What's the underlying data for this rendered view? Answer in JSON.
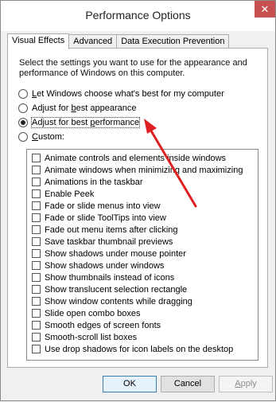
{
  "window": {
    "title": "Performance Options",
    "close_glyph": "✕"
  },
  "tabs": [
    {
      "label": "Visual Effects",
      "active": true
    },
    {
      "label": "Advanced",
      "active": false
    },
    {
      "label": "Data Execution Prevention",
      "active": false
    }
  ],
  "panel": {
    "description": "Select the settings you want to use for the appearance and performance of Windows on this computer.",
    "radios": [
      {
        "pre": "",
        "key": "L",
        "post": "et Windows choose what's best for my computer",
        "checked": false
      },
      {
        "pre": "Adjust for ",
        "key": "b",
        "post": "est appearance",
        "checked": false
      },
      {
        "pre": "Adjust for best ",
        "key": "p",
        "post": "erformance",
        "checked": true
      },
      {
        "pre": "",
        "key": "C",
        "post": "ustom:",
        "checked": false
      }
    ],
    "effects": [
      "Animate controls and elements inside windows",
      "Animate windows when minimizing and maximizing",
      "Animations in the taskbar",
      "Enable Peek",
      "Fade or slide menus into view",
      "Fade or slide ToolTips into view",
      "Fade out menu items after clicking",
      "Save taskbar thumbnail previews",
      "Show shadows under mouse pointer",
      "Show shadows under windows",
      "Show thumbnails instead of icons",
      "Show translucent selection rectangle",
      "Show window contents while dragging",
      "Slide open combo boxes",
      "Smooth edges of screen fonts",
      "Smooth-scroll list boxes",
      "Use drop shadows for icon labels on the desktop"
    ]
  },
  "buttons": {
    "ok": "OK",
    "cancel": "Cancel",
    "apply_pre": "",
    "apply_key": "A",
    "apply_post": "pply"
  },
  "colors": {
    "arrow": "#e02020",
    "close_bg": "#c75050"
  },
  "icons": {
    "arrow": "red-annotation-arrow"
  }
}
